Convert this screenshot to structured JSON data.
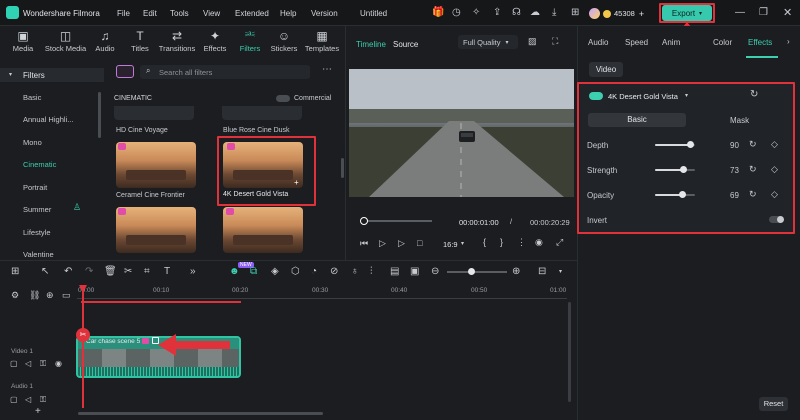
{
  "titlebar": {
    "app_name": "Wondershare Filmora",
    "menu": [
      "File",
      "Edit",
      "Tools",
      "View",
      "Extended",
      "Help",
      "Version"
    ],
    "project": "Untitled",
    "credits": "45308",
    "export_label": "Export"
  },
  "toolbox": {
    "items": [
      "Media",
      "Stock Media",
      "Audio",
      "Titles",
      "Transitions",
      "Effects",
      "Filters",
      "Stickers",
      "Templates"
    ]
  },
  "filters": {
    "heading": "Filters",
    "search_placeholder": "Search all filters",
    "categories": [
      "Basic",
      "Annual Highli...",
      "Mono",
      "Cinematic",
      "Portrait",
      "Summer",
      "Lifestyle",
      "Valentine"
    ],
    "section": "CINEMATIC",
    "commercial_label": "Commercial",
    "cards": [
      "HD Cine Voyage",
      "Blue Rose Cine Dusk",
      "Ceramel Cine Frontier",
      "4K Desert Gold Vista"
    ]
  },
  "viewer": {
    "tab_timeline": "Timeline",
    "tab_source": "Source",
    "quality": "Full Quality",
    "current_time": "00:00:01:00",
    "total_time": "00:00:20:29",
    "ratio": "16:9"
  },
  "rpanel": {
    "tabs": [
      "Audio",
      "Speed",
      "Anim",
      "Color",
      "Effects"
    ],
    "sub_tab": "Video",
    "effect_name": "4K Desert Gold Vista",
    "mode_basic": "Basic",
    "mode_mask": "Mask",
    "params": [
      {
        "label": "Depth",
        "value": "90",
        "level": 0.9
      },
      {
        "label": "Strength",
        "value": "73",
        "level": 0.73
      },
      {
        "label": "Opacity",
        "value": "69",
        "level": 0.69
      }
    ],
    "invert_label": "Invert",
    "reset_label": "Reset"
  },
  "timeline": {
    "ticks": [
      "00:00",
      "00:10",
      "00:20",
      "00:30",
      "00:40",
      "00:50",
      "01:00"
    ],
    "video_track": "Video 1",
    "audio_track": "Audio 1",
    "clip_name": "Car chase scene 5",
    "ai_badge": "NEW"
  },
  "colors": {
    "accent": "#3ccfb0",
    "highlight": "#e0323a"
  }
}
